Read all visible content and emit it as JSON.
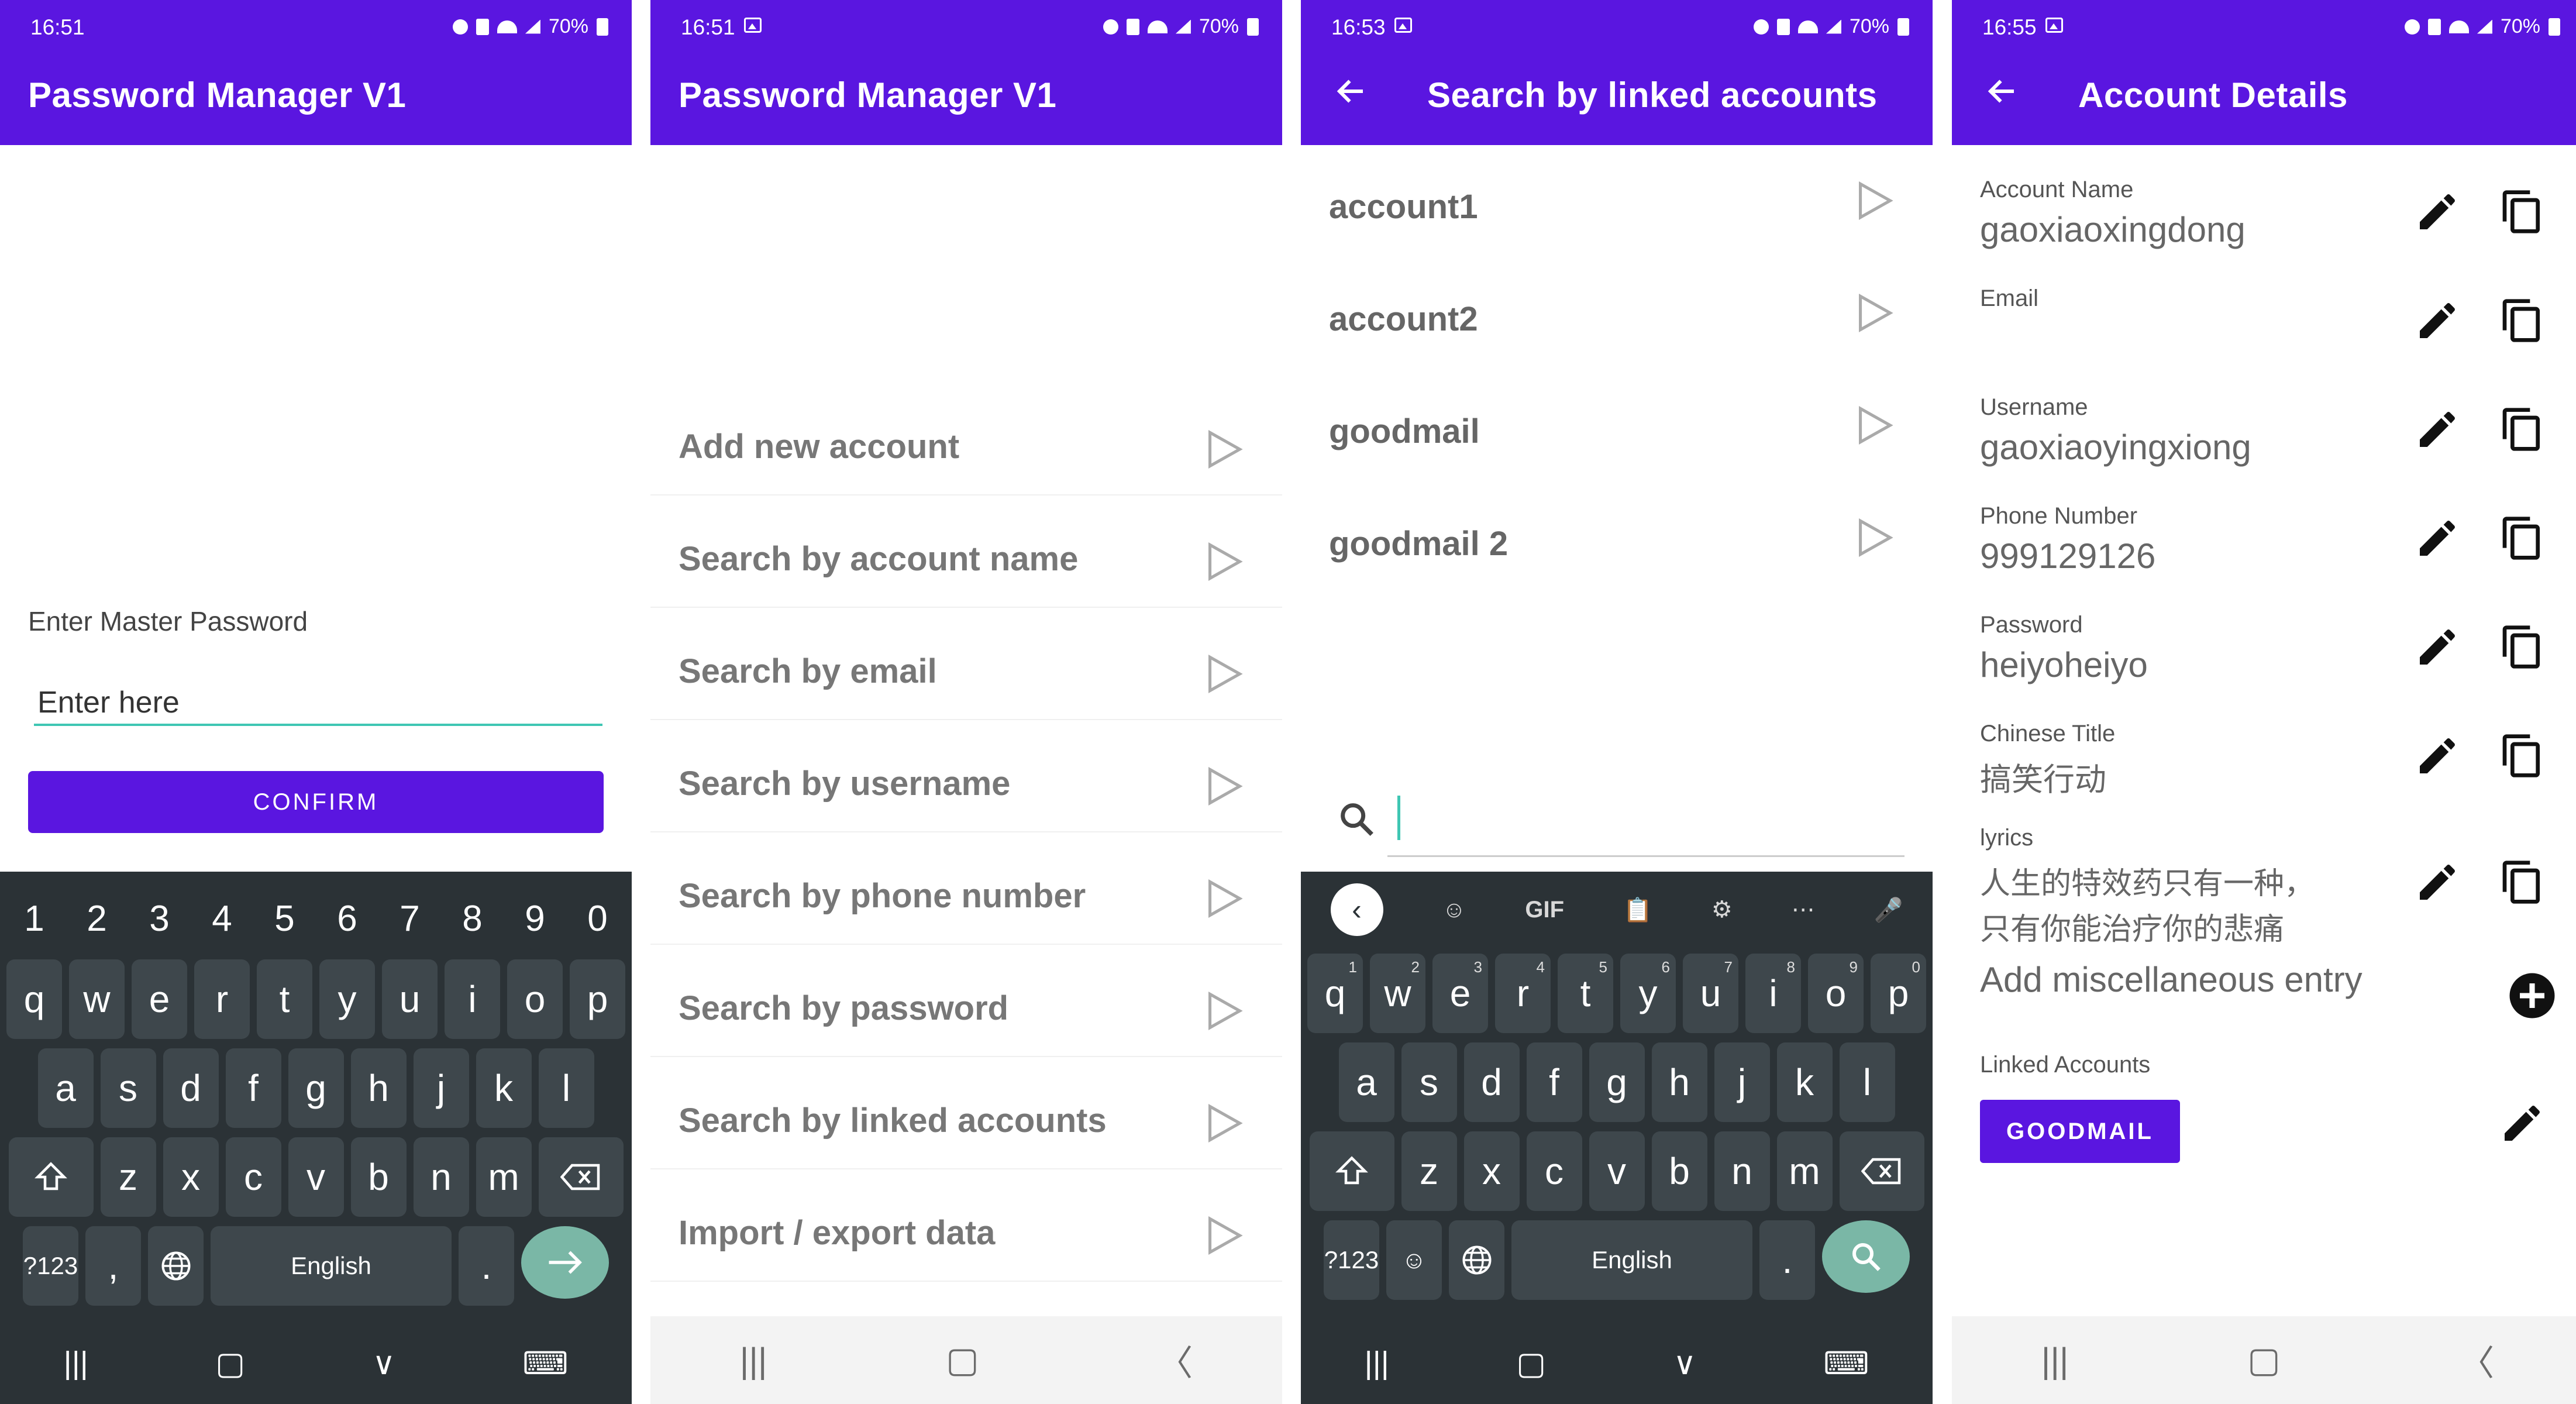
{
  "status": {
    "panel1_time": "16:51",
    "panel2_time": "16:51",
    "panel3_time": "16:53",
    "panel4_time": "16:55",
    "battery": "70%"
  },
  "colors": {
    "primary": "#5a16e0",
    "accent": "#3fc6b3",
    "keyboard": "#2b3236"
  },
  "app": {
    "title": "Password Manager V1"
  },
  "login": {
    "label": "Enter Master Password",
    "placeholder": "Enter here",
    "confirm": "CONFIRM"
  },
  "keyboard1": {
    "numbers": [
      "1",
      "2",
      "3",
      "4",
      "5",
      "6",
      "7",
      "8",
      "9",
      "0"
    ],
    "row1": [
      "q",
      "w",
      "e",
      "r",
      "t",
      "y",
      "u",
      "i",
      "o",
      "p"
    ],
    "row2": [
      "a",
      "s",
      "d",
      "f",
      "g",
      "h",
      "j",
      "k",
      "l"
    ],
    "row3": [
      "z",
      "x",
      "c",
      "v",
      "b",
      "n",
      "m"
    ],
    "symbols": "?123",
    "comma": ",",
    "space": "English",
    "period": "."
  },
  "menu": {
    "items": [
      "Add new account",
      "Search by account name",
      "Search by email",
      "Search by username",
      "Search by phone number",
      "Search by password",
      "Search by linked accounts",
      "Import / export data"
    ]
  },
  "linked_search": {
    "title": "Search by linked accounts",
    "items": [
      "account1",
      "account2",
      "goodmail",
      "goodmail 2"
    ]
  },
  "keyboard2": {
    "toolbar": [
      "GIF"
    ],
    "row1": [
      "q",
      "w",
      "e",
      "r",
      "t",
      "y",
      "u",
      "i",
      "o",
      "p"
    ],
    "row1_hints": [
      "1",
      "2",
      "3",
      "4",
      "5",
      "6",
      "7",
      "8",
      "9",
      "0"
    ],
    "row2": [
      "a",
      "s",
      "d",
      "f",
      "g",
      "h",
      "j",
      "k",
      "l"
    ],
    "row3": [
      "z",
      "x",
      "c",
      "v",
      "b",
      "n",
      "m"
    ],
    "symbols": "?123",
    "space": "English",
    "period": "."
  },
  "details": {
    "title": "Account Details",
    "fields": [
      {
        "label": "Account Name",
        "value": "gaoxiaoxingdong"
      },
      {
        "label": "Email",
        "value": ""
      },
      {
        "label": "Username",
        "value": "gaoxiaoyingxiong"
      },
      {
        "label": "Phone Number",
        "value": "999129126"
      },
      {
        "label": "Password",
        "value": "heiyoheiyo"
      },
      {
        "label": "Chinese Title",
        "value": "搞笑行动"
      },
      {
        "label": "lyrics",
        "value": "人生的特效药只有一种，",
        "value2": "只有你能治疗你的悲痛"
      }
    ],
    "misc": "Add miscellaneous entry",
    "linked_label": "Linked Accounts",
    "linked_button": "GOODMAIL"
  }
}
